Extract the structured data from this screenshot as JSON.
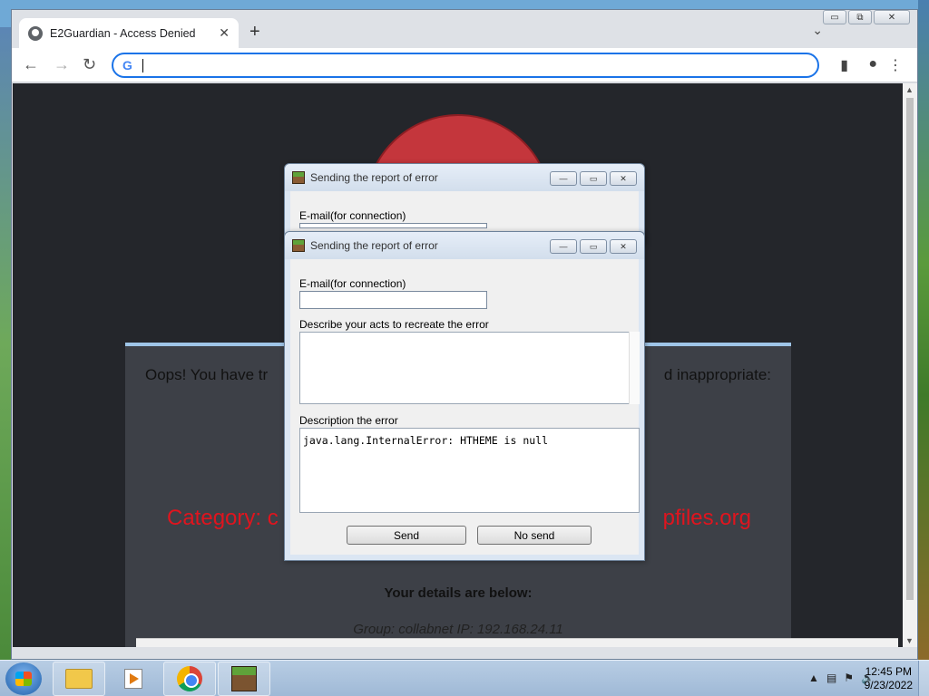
{
  "browser": {
    "tab_title": "E2Guardian - Access Denied",
    "tab_close": "✕",
    "new_tab": "+",
    "tab_dropdown": "⌄",
    "url_value": "",
    "search_engine_icon": "G",
    "window_controls": {
      "minimize": "▭",
      "maximize": "⧉",
      "close": "✕"
    }
  },
  "page": {
    "oops_left": "Oops! You have tr",
    "oops_right": "d inappropriate:",
    "category_left": "Category: c",
    "category_right": "pfiles.org",
    "details_heading": "Your details are below:",
    "group_line": "Group: collabnet   IP: 192.168.24.11"
  },
  "dialog_back": {
    "title": "Sending the report of error",
    "email_label": "E-mail(for connection)"
  },
  "dialog_front": {
    "title": "Sending the report of error",
    "email_label": "E-mail(for connection)",
    "email_value": "",
    "acts_label": "Describe your acts to recreate the error",
    "acts_value": "",
    "error_label": "Description the error",
    "error_value": "java.lang.InternalError: HTHEME is null",
    "send_button": "Send",
    "nosend_button": "No send",
    "controls": {
      "minimize": "—",
      "maximize": "▭",
      "close": "✕"
    }
  },
  "taskbar": {
    "time": "12:45 PM",
    "date": "9/23/2022",
    "tray_arrow": "▲"
  },
  "colors": {
    "omnibox_focus": "#1a73e8",
    "category_text": "#e0141e",
    "stop_sign": "#c4363c",
    "page_background": "#24262b",
    "card_background": "#3d4047"
  }
}
